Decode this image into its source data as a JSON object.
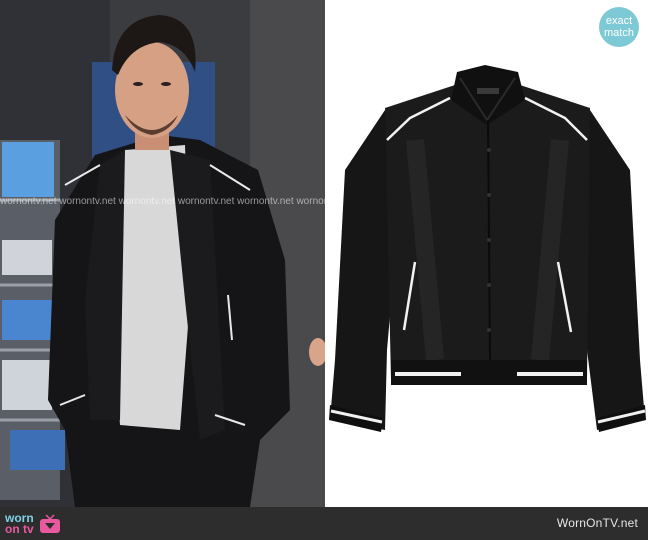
{
  "badge": {
    "line1": "exact",
    "line2": "match"
  },
  "watermark": {
    "text": "wornontv.net wornontv.net wornontv.net wornontv.net wornontv.net wornontv.net"
  },
  "footer": {
    "logo_line1": "worn",
    "logo_line2": "on tv",
    "site": "WornOnTV.net"
  },
  "colors": {
    "badge": "#7ec9d6",
    "logo_blue": "#7fd0e8",
    "logo_pink": "#e85aa0",
    "footer_bg": "#2d2d2d"
  },
  "icons": [
    "tv-icon"
  ]
}
